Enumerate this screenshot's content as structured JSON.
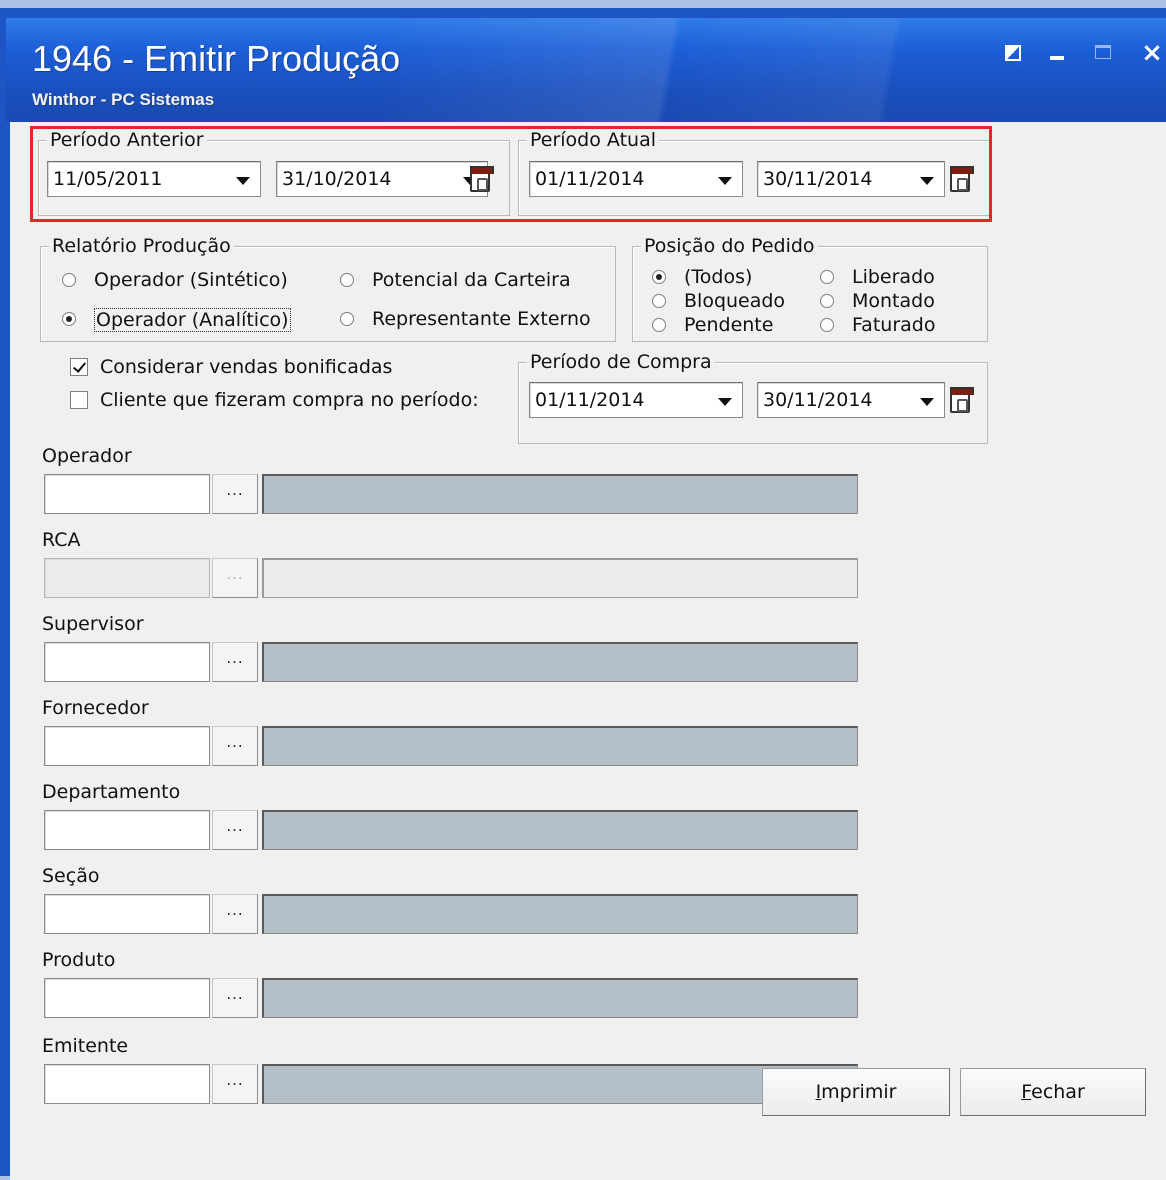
{
  "window": {
    "title": "1946 - Emitir Produção",
    "subtitle": "Winthor - PC Sistemas",
    "controls": {
      "restore": "restore-icon",
      "minimize": "minimize-icon",
      "maximize": "maximize-icon",
      "close": "×"
    }
  },
  "periodo_anterior": {
    "label": "Período Anterior",
    "start_date": "11/05/2011",
    "end_date": "31/10/2014"
  },
  "periodo_atual": {
    "label": "Período Atual",
    "start_date": "01/11/2014",
    "end_date": "30/11/2014"
  },
  "relatorio": {
    "label": "Relatório Produção",
    "options": [
      {
        "label": "Operador (Sintético)",
        "selected": false
      },
      {
        "label": "Potencial da Carteira",
        "selected": false
      },
      {
        "label": "Operador (Analítico)",
        "selected": true
      },
      {
        "label": "Representante Externo",
        "selected": false
      }
    ]
  },
  "posicao": {
    "label": "Posição do Pedido",
    "options": [
      {
        "label": "(Todos)",
        "selected": true
      },
      {
        "label": "Liberado",
        "selected": false
      },
      {
        "label": "Bloqueado",
        "selected": false
      },
      {
        "label": "Montado",
        "selected": false
      },
      {
        "label": "Pendente",
        "selected": false
      },
      {
        "label": "Faturado",
        "selected": false
      }
    ]
  },
  "checks": {
    "bonificadas": {
      "label": "Considerar vendas bonificadas",
      "checked": true
    },
    "clientes": {
      "label": "Cliente que fizeram compra no período:",
      "checked": false
    }
  },
  "periodo_compra": {
    "label": "Período de Compra",
    "start_date": "01/11/2014",
    "end_date": "30/11/2014"
  },
  "lookups": [
    {
      "label": "Operador",
      "enabled": true
    },
    {
      "label": "RCA",
      "enabled": false
    },
    {
      "label": "Supervisor",
      "enabled": true
    },
    {
      "label": "Fornecedor",
      "enabled": true
    },
    {
      "label": "Departamento",
      "enabled": true
    },
    {
      "label": "Seção",
      "enabled": true
    },
    {
      "label": "Produto",
      "enabled": true
    },
    {
      "label": "Emitente",
      "enabled": true
    }
  ],
  "lookup_button_label": "...",
  "buttons": {
    "imprimir": {
      "mnemonic": "I",
      "rest": "mprimir"
    },
    "fechar": {
      "mnemonic": "F",
      "rest": "echar"
    }
  },
  "colors": {
    "title_bar": "#1d5fd7",
    "highlight_border": "#e2262b",
    "client_background": "#f0f0ef",
    "description_field": "#b4bfc7"
  }
}
